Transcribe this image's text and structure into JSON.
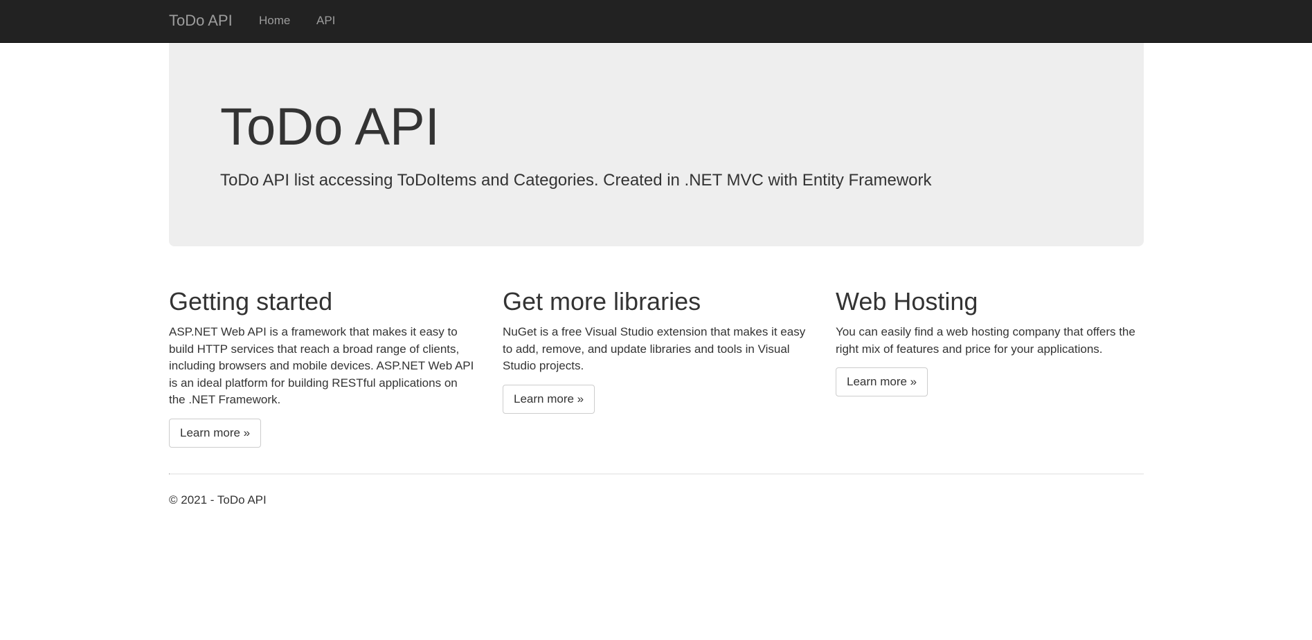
{
  "navbar": {
    "brand": "ToDo API",
    "links": [
      {
        "label": "Home"
      },
      {
        "label": "API"
      }
    ]
  },
  "jumbotron": {
    "title": "ToDo API",
    "lead": "ToDo API list accessing ToDoItems and Categories. Created in .NET MVC with Entity Framework"
  },
  "columns": [
    {
      "heading": "Getting started",
      "text": "ASP.NET Web API is a framework that makes it easy to build HTTP services that reach a broad range of clients, including browsers and mobile devices. ASP.NET Web API is an ideal platform for building RESTful applications on the .NET Framework.",
      "button": "Learn more »"
    },
    {
      "heading": "Get more libraries",
      "text": "NuGet is a free Visual Studio extension that makes it easy to add, remove, and update libraries and tools in Visual Studio projects.",
      "button": "Learn more »"
    },
    {
      "heading": "Web Hosting",
      "text": "You can easily find a web hosting company that offers the right mix of features and price for your applications.",
      "button": "Learn more »"
    }
  ],
  "footer": {
    "text": "© 2021 - ToDo API"
  },
  "colors": {
    "navbar_bg": "#222222",
    "nav_text": "#9d9d9d",
    "jumbotron_bg": "#eeeeee",
    "text": "#333333"
  }
}
